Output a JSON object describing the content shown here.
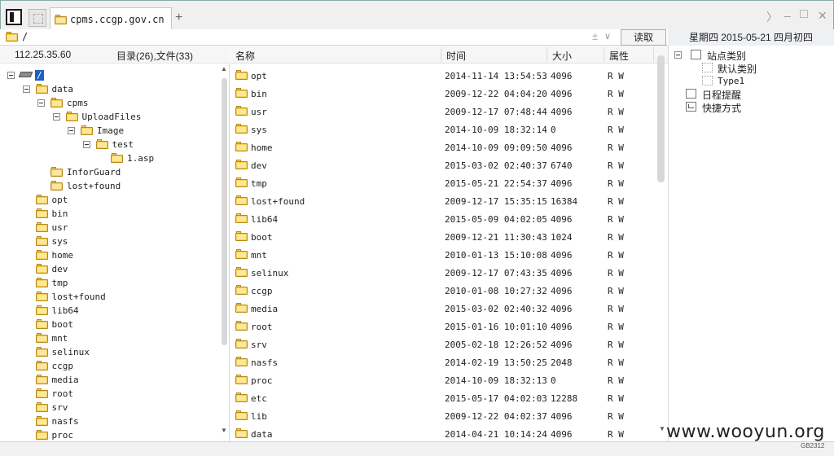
{
  "titlebar": {
    "tab_label": "cpms.ccgp.gov.cn",
    "add_tab_glyph": "+",
    "nav_glyph": "〉",
    "minimize_glyph": "–",
    "maximize_glyph": "□",
    "close_glyph": "✕"
  },
  "address": {
    "path": "/",
    "plusminus_glyph": "±",
    "dropdown_glyph": "∨",
    "read_button": "读取"
  },
  "date_bar": "星期四 2015-05-21 四月初四",
  "tree": {
    "ip": "112.25.35.60",
    "counts": "目录(26),文件(33)",
    "root_label": "/",
    "rows": [
      {
        "label": "data"
      },
      {
        "label": "cpms"
      },
      {
        "label": "UploadFiles"
      },
      {
        "label": "Image"
      },
      {
        "label": "test"
      },
      {
        "label": "1.asp"
      },
      {
        "label": "InforGuard"
      },
      {
        "label": "lost+found"
      },
      {
        "label": "opt"
      },
      {
        "label": "bin"
      },
      {
        "label": "usr"
      },
      {
        "label": "sys"
      },
      {
        "label": "home"
      },
      {
        "label": "dev"
      },
      {
        "label": "tmp"
      },
      {
        "label": "lost+found"
      },
      {
        "label": "lib64"
      },
      {
        "label": "boot"
      },
      {
        "label": "mnt"
      },
      {
        "label": "selinux"
      },
      {
        "label": "ccgp"
      },
      {
        "label": "media"
      },
      {
        "label": "root"
      },
      {
        "label": "srv"
      },
      {
        "label": "nasfs"
      },
      {
        "label": "proc"
      }
    ]
  },
  "list": {
    "columns": {
      "name": "名称",
      "time": "时间",
      "size": "大小",
      "attr": "属性"
    },
    "rows": [
      {
        "name": "opt",
        "time": "2014-11-14 13:54:53",
        "size": "4096",
        "attr": "R W"
      },
      {
        "name": "bin",
        "time": "2009-12-22 04:04:20",
        "size": "4096",
        "attr": "R W"
      },
      {
        "name": "usr",
        "time": "2009-12-17 07:48:44",
        "size": "4096",
        "attr": "R W"
      },
      {
        "name": "sys",
        "time": "2014-10-09 18:32:14",
        "size": "0",
        "attr": "R W"
      },
      {
        "name": "home",
        "time": "2014-10-09 09:09:50",
        "size": "4096",
        "attr": "R W"
      },
      {
        "name": "dev",
        "time": "2015-03-02 02:40:37",
        "size": "6740",
        "attr": "R W"
      },
      {
        "name": "tmp",
        "time": "2015-05-21 22:54:37",
        "size": "4096",
        "attr": "R W"
      },
      {
        "name": "lost+found",
        "time": "2009-12-17 15:35:15",
        "size": "16384",
        "attr": "R W"
      },
      {
        "name": "lib64",
        "time": "2015-05-09 04:02:05",
        "size": "4096",
        "attr": "R W"
      },
      {
        "name": "boot",
        "time": "2009-12-21 11:30:43",
        "size": "1024",
        "attr": "R W"
      },
      {
        "name": "mnt",
        "time": "2010-01-13 15:10:08",
        "size": "4096",
        "attr": "R W"
      },
      {
        "name": "selinux",
        "time": "2009-12-17 07:43:35",
        "size": "4096",
        "attr": "R W"
      },
      {
        "name": "ccgp",
        "time": "2010-01-08 10:27:32",
        "size": "4096",
        "attr": "R W"
      },
      {
        "name": "media",
        "time": "2015-03-02 02:40:32",
        "size": "4096",
        "attr": "R W"
      },
      {
        "name": "root",
        "time": "2015-01-16 10:01:10",
        "size": "4096",
        "attr": "R W"
      },
      {
        "name": "srv",
        "time": "2005-02-18 12:26:52",
        "size": "4096",
        "attr": "R W"
      },
      {
        "name": "nasfs",
        "time": "2014-02-19 13:50:25",
        "size": "2048",
        "attr": "R W"
      },
      {
        "name": "proc",
        "time": "2014-10-09 18:32:13",
        "size": "0",
        "attr": "R W"
      },
      {
        "name": "etc",
        "time": "2015-05-17 04:02:03",
        "size": "12288",
        "attr": "R W"
      },
      {
        "name": "lib",
        "time": "2009-12-22 04:02:37",
        "size": "4096",
        "attr": "R W"
      },
      {
        "name": "data",
        "time": "2014-04-21 10:14:24",
        "size": "4096",
        "attr": "R W"
      }
    ]
  },
  "sidebar": {
    "site_category": "站点类别",
    "default_category": "默认类别",
    "type1": "Type1",
    "schedule": "日程提醒",
    "shortcuts": "快捷方式"
  },
  "watermark": {
    "text": "www.wooyun.org",
    "code": "GB2312"
  },
  "colors": {
    "folder": "#f4cf5a",
    "selection": "#1e5fc2"
  }
}
